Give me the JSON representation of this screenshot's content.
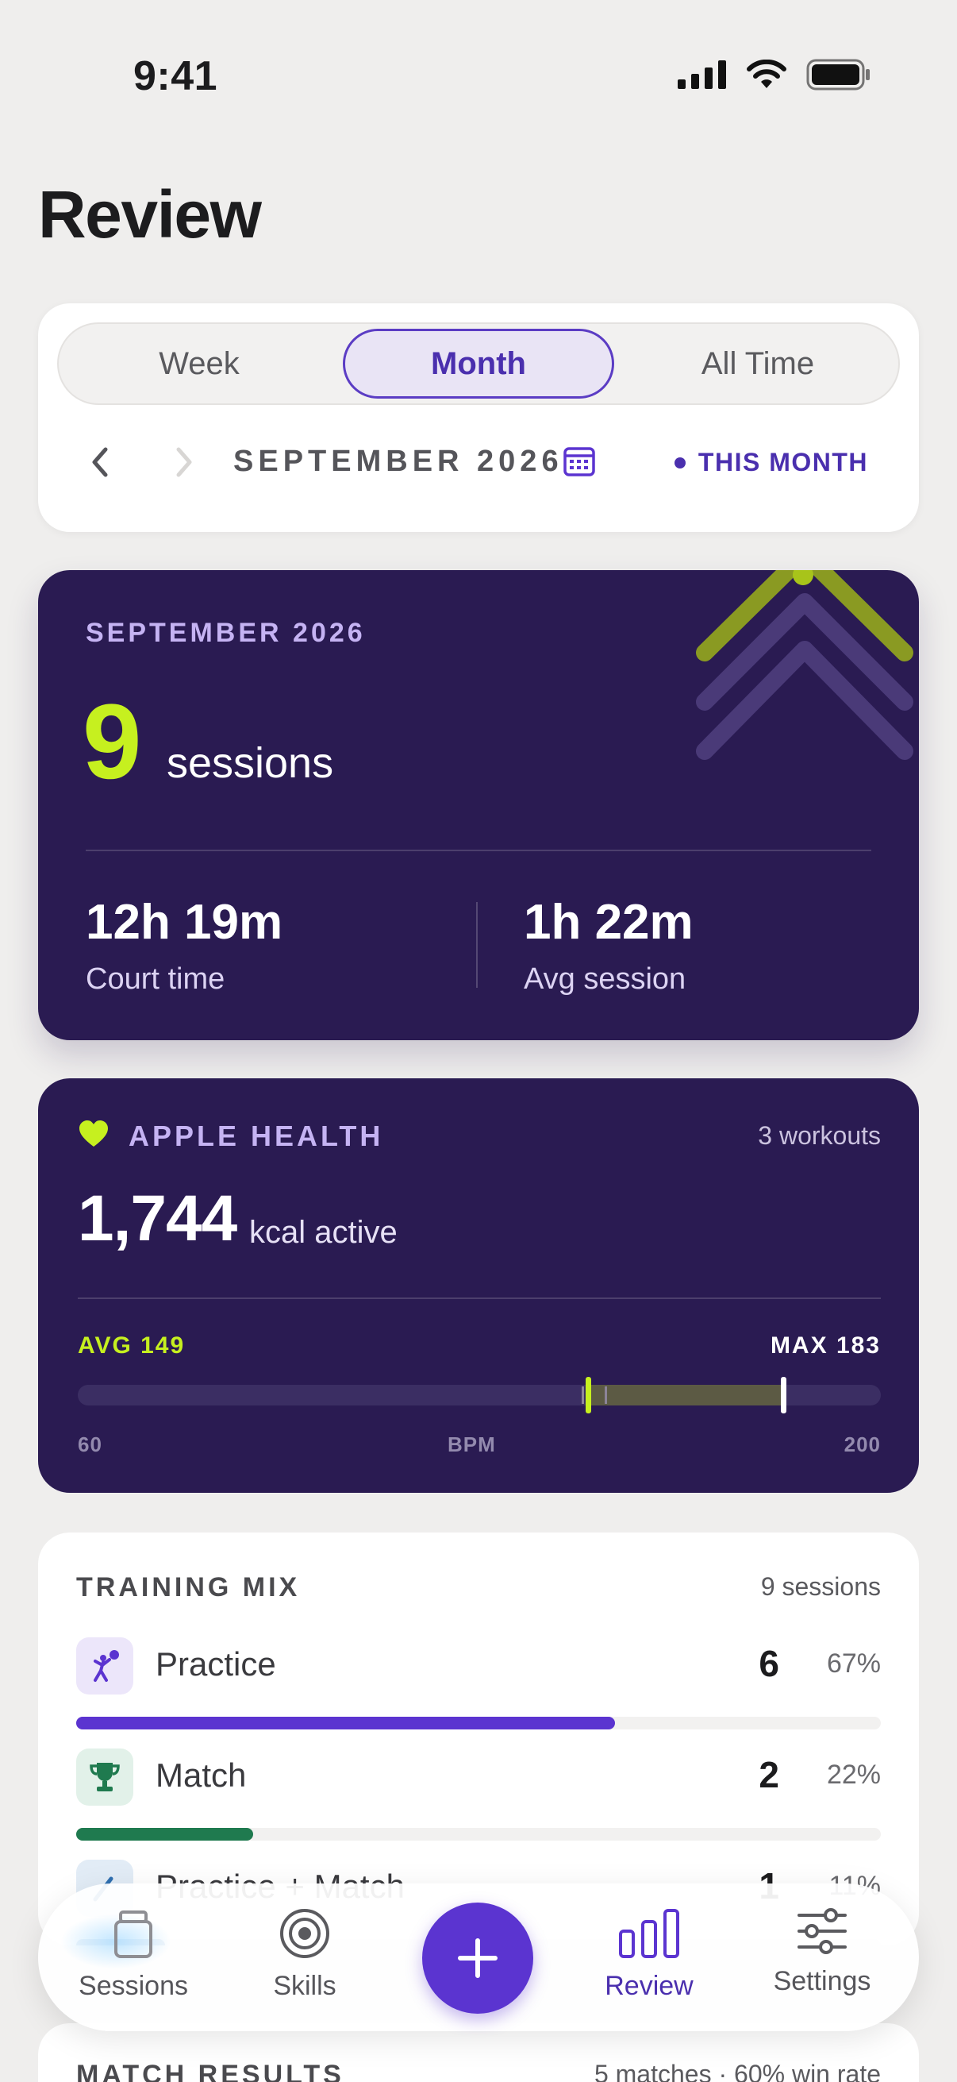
{
  "status_bar": {
    "time": "9:41"
  },
  "page": {
    "title": "Review"
  },
  "period": {
    "segments": [
      "Week",
      "Month",
      "All Time"
    ],
    "selected": "Month",
    "label": "SEPTEMBER 2026",
    "this_month": "THIS MONTH"
  },
  "summary": {
    "month": "SEPTEMBER 2026",
    "sessions_count": "9",
    "sessions_unit": "sessions",
    "court_time_value": "12h 19m",
    "court_time_label": "Court time",
    "avg_session_value": "1h 22m",
    "avg_session_label": "Avg session"
  },
  "health": {
    "title": "APPLE HEALTH",
    "workouts": "3 workouts",
    "kcal": "1,744",
    "kcal_unit": "kcal active",
    "avg_label": "AVG 149",
    "max_label": "MAX 183",
    "axis_min": "60",
    "axis_mid": "BPM",
    "axis_max": "200",
    "bpm_min": 60,
    "bpm_max": 200,
    "bpm_avg": 149,
    "bpm_peak": 183,
    "tick_values": [
      148,
      152
    ]
  },
  "training_mix": {
    "title": "TRAINING MIX",
    "count": "9 sessions",
    "items": [
      {
        "name": "Practice",
        "count": "6",
        "pct": "67%",
        "fraction": 0.67,
        "color": "#5b34d0",
        "icon": "volleyball-player-icon",
        "icon_bg": "#ece6fa"
      },
      {
        "name": "Match",
        "count": "2",
        "pct": "22%",
        "fraction": 0.22,
        "color": "#1f7a4f",
        "icon": "trophy-icon",
        "icon_bg": "#e2f1e9"
      },
      {
        "name": "Practice + Match",
        "count": "1",
        "pct": "11%",
        "fraction": 0.11,
        "color": "#2f6fb0",
        "icon": "combo-icon",
        "icon_bg": "#e2ecf6"
      }
    ]
  },
  "match_results": {
    "title": "MATCH RESULTS",
    "subtitle": "5 matches · 60% win rate"
  },
  "tab_bar": {
    "tabs": [
      {
        "label": "Sessions",
        "icon": "cup-icon"
      },
      {
        "label": "Skills",
        "icon": "target-icon"
      },
      {
        "label": "Review",
        "icon": "bar-chart-icon"
      },
      {
        "label": "Settings",
        "icon": "sliders-icon"
      }
    ],
    "active": "Review"
  },
  "colors": {
    "accent": "#5b34d0",
    "dark_card": "#2a1b52",
    "lime": "#c6f01f"
  }
}
